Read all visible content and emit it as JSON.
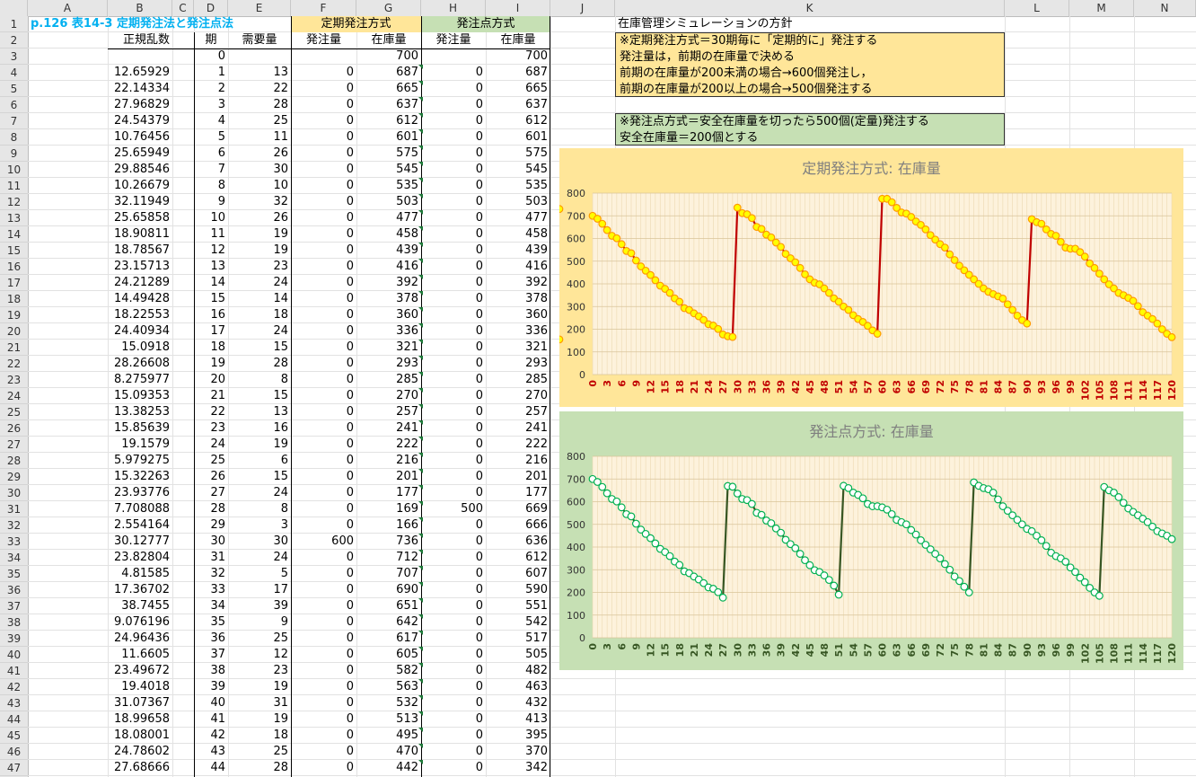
{
  "columns": [
    "A",
    "B",
    "C",
    "D",
    "E",
    "F",
    "G",
    "H",
    "I",
    "J",
    "K",
    "L",
    "M",
    "N"
  ],
  "rows": [
    1,
    2,
    3,
    4,
    5,
    6,
    7,
    8,
    9,
    10,
    11,
    12,
    13,
    14,
    15,
    16,
    17,
    18,
    19,
    20,
    21,
    22,
    23,
    24,
    25,
    26,
    27,
    28,
    29,
    30,
    31,
    32,
    33,
    34,
    35,
    36,
    37,
    38,
    39,
    40,
    41,
    42,
    43,
    44,
    45,
    46,
    47
  ],
  "title": "p.126 表14-3 定期発注法と発注点法",
  "headers": {
    "group_f": "定期発注方式",
    "group_h": "発注点方式",
    "b": "正規乱数",
    "d": "期",
    "e": "需要量",
    "f": "発注量",
    "g": "在庫量",
    "h": "発注量",
    "i": "在庫量"
  },
  "initial": {
    "d": "0",
    "g": "700",
    "i": "700"
  },
  "table": [
    [
      "12.65929",
      "1",
      "13",
      "0",
      "687",
      "0",
      "687"
    ],
    [
      "22.14334",
      "2",
      "22",
      "0",
      "665",
      "0",
      "665"
    ],
    [
      "27.96829",
      "3",
      "28",
      "0",
      "637",
      "0",
      "637"
    ],
    [
      "24.54379",
      "4",
      "25",
      "0",
      "612",
      "0",
      "612"
    ],
    [
      "10.76456",
      "5",
      "11",
      "0",
      "601",
      "0",
      "601"
    ],
    [
      "25.65949",
      "6",
      "26",
      "0",
      "575",
      "0",
      "575"
    ],
    [
      "29.88546",
      "7",
      "30",
      "0",
      "545",
      "0",
      "545"
    ],
    [
      "10.26679",
      "8",
      "10",
      "0",
      "535",
      "0",
      "535"
    ],
    [
      "32.11949",
      "9",
      "32",
      "0",
      "503",
      "0",
      "503"
    ],
    [
      "25.65858",
      "10",
      "26",
      "0",
      "477",
      "0",
      "477"
    ],
    [
      "18.90811",
      "11",
      "19",
      "0",
      "458",
      "0",
      "458"
    ],
    [
      "18.78567",
      "12",
      "19",
      "0",
      "439",
      "0",
      "439"
    ],
    [
      "23.15713",
      "13",
      "23",
      "0",
      "416",
      "0",
      "416"
    ],
    [
      "24.21289",
      "14",
      "24",
      "0",
      "392",
      "0",
      "392"
    ],
    [
      "14.49428",
      "15",
      "14",
      "0",
      "378",
      "0",
      "378"
    ],
    [
      "18.22553",
      "16",
      "18",
      "0",
      "360",
      "0",
      "360"
    ],
    [
      "24.40934",
      "17",
      "24",
      "0",
      "336",
      "0",
      "336"
    ],
    [
      "15.0918",
      "18",
      "15",
      "0",
      "321",
      "0",
      "321"
    ],
    [
      "28.26608",
      "19",
      "28",
      "0",
      "293",
      "0",
      "293"
    ],
    [
      "8.275977",
      "20",
      "8",
      "0",
      "285",
      "0",
      "285"
    ],
    [
      "15.09353",
      "21",
      "15",
      "0",
      "270",
      "0",
      "270"
    ],
    [
      "13.38253",
      "22",
      "13",
      "0",
      "257",
      "0",
      "257"
    ],
    [
      "15.85639",
      "23",
      "16",
      "0",
      "241",
      "0",
      "241"
    ],
    [
      "19.1579",
      "24",
      "19",
      "0",
      "222",
      "0",
      "222"
    ],
    [
      "5.979275",
      "25",
      "6",
      "0",
      "216",
      "0",
      "216"
    ],
    [
      "15.32263",
      "26",
      "15",
      "0",
      "201",
      "0",
      "201"
    ],
    [
      "23.93776",
      "27",
      "24",
      "0",
      "177",
      "0",
      "177"
    ],
    [
      "7.708088",
      "28",
      "8",
      "0",
      "169",
      "500",
      "669"
    ],
    [
      "2.554164",
      "29",
      "3",
      "0",
      "166",
      "0",
      "666"
    ],
    [
      "30.12777",
      "30",
      "30",
      "600",
      "736",
      "0",
      "636"
    ],
    [
      "23.82804",
      "31",
      "24",
      "0",
      "712",
      "0",
      "612"
    ],
    [
      "4.81585",
      "32",
      "5",
      "0",
      "707",
      "0",
      "607"
    ],
    [
      "17.36702",
      "33",
      "17",
      "0",
      "690",
      "0",
      "590"
    ],
    [
      "38.7455",
      "34",
      "39",
      "0",
      "651",
      "0",
      "551"
    ],
    [
      "9.076196",
      "35",
      "9",
      "0",
      "642",
      "0",
      "542"
    ],
    [
      "24.96436",
      "36",
      "25",
      "0",
      "617",
      "0",
      "517"
    ],
    [
      "11.6605",
      "37",
      "12",
      "0",
      "605",
      "0",
      "505"
    ],
    [
      "23.49672",
      "38",
      "23",
      "0",
      "582",
      "0",
      "482"
    ],
    [
      "19.4018",
      "39",
      "19",
      "0",
      "563",
      "0",
      "463"
    ],
    [
      "31.07367",
      "40",
      "31",
      "0",
      "532",
      "0",
      "432"
    ],
    [
      "18.99658",
      "41",
      "19",
      "0",
      "513",
      "0",
      "413"
    ],
    [
      "18.08001",
      "42",
      "18",
      "0",
      "495",
      "0",
      "395"
    ],
    [
      "24.78602",
      "43",
      "25",
      "0",
      "470",
      "0",
      "370"
    ],
    [
      "27.68666",
      "44",
      "28",
      "0",
      "442",
      "0",
      "342"
    ]
  ],
  "notes": {
    "heading": "在庫管理シミュレーションの方針",
    "box1": [
      "※定期発注方式＝30期毎に「定期的に」発注する",
      "発注量は，前期の在庫量で決める",
      "前期の在庫量が200未満の場合→600個発注し，",
      "前期の在庫量が200以上の場合→500個発注する"
    ],
    "box2": [
      "※発注点方式＝安全在庫量を切ったら500個(定量)発注する",
      "安全在庫量＝200個とする"
    ]
  },
  "colors": {
    "orange_fill": "#ffe699",
    "green_fill": "#c6e0b4",
    "title_blue": "#00b0f0",
    "line_red": "#c00000",
    "marker_yellow": "#ffff00",
    "line_green": "#375623",
    "marker_green": "#00b050",
    "tick_green": "#375623"
  },
  "chart_data": [
    {
      "type": "line",
      "title": "定期発注方式: 在庫量",
      "ylim": [
        0,
        800
      ],
      "yticks": [
        "0",
        "100",
        "200",
        "300",
        "400",
        "500",
        "600",
        "700",
        "800"
      ],
      "xticks": [
        "0",
        "3",
        "6",
        "9",
        "12",
        "15",
        "18",
        "21",
        "24",
        "27",
        "30",
        "33",
        "36",
        "39",
        "42",
        "45",
        "48",
        "51",
        "54",
        "57",
        "60",
        "63",
        "66",
        "69",
        "72",
        "75",
        "78",
        "81",
        "84",
        "87",
        "90",
        "93",
        "96",
        "99",
        "102",
        "105",
        "108",
        "111",
        "114",
        "117",
        "120"
      ],
      "grid": true,
      "x": [
        0,
        1,
        2,
        3,
        4,
        5,
        6,
        7,
        8,
        9,
        10,
        11,
        12,
        13,
        14,
        15,
        16,
        17,
        18,
        19,
        20,
        21,
        22,
        23,
        24,
        25,
        26,
        27,
        28,
        29,
        30,
        31,
        32,
        33,
        34,
        35,
        36,
        37,
        38,
        39,
        40,
        41,
        42,
        43,
        44,
        45,
        46,
        47,
        48,
        49,
        50,
        51,
        52,
        53,
        54,
        55,
        56,
        57,
        58,
        59,
        60,
        61,
        62,
        63,
        64,
        65,
        66,
        67,
        68,
        69,
        70,
        71,
        72,
        73,
        74,
        75,
        76,
        77,
        78,
        79,
        80,
        81,
        82,
        83,
        84,
        85,
        86,
        87,
        88,
        89,
        90,
        91,
        92,
        93,
        94,
        95,
        96,
        97,
        98,
        99,
        100,
        101,
        102,
        103,
        104,
        105,
        106,
        107,
        108,
        109,
        110,
        111,
        112,
        113,
        114,
        115,
        116,
        117,
        118,
        119,
        120
      ],
      "values": [
        700,
        687,
        665,
        637,
        612,
        601,
        575,
        545,
        535,
        503,
        477,
        458,
        439,
        416,
        392,
        378,
        360,
        336,
        321,
        293,
        285,
        270,
        257,
        241,
        222,
        216,
        201,
        177,
        169,
        166,
        736,
        712,
        707,
        690,
        651,
        642,
        617,
        605,
        582,
        563,
        532,
        513,
        495,
        470,
        442,
        420,
        405,
        398,
        380,
        360,
        336,
        321,
        300,
        285,
        262,
        245,
        232,
        215,
        195,
        180,
        775,
        775,
        760,
        735,
        715,
        710,
        695,
        675,
        660,
        640,
        615,
        595,
        575,
        560,
        530,
        505,
        480,
        460,
        440,
        420,
        400,
        380,
        365,
        355,
        345,
        335,
        310,
        285,
        260,
        240,
        225,
        685,
        672,
        665,
        640,
        620,
        612,
        585,
        560,
        555,
        555,
        540,
        520,
        490,
        470,
        445,
        420,
        398,
        380,
        360,
        350,
        338,
        325,
        302,
        275,
        260,
        245,
        225,
        200,
        180,
        165,
        155,
        730
      ]
    },
    {
      "type": "line",
      "title": "発注点方式: 在庫量",
      "ylim": [
        0,
        800
      ],
      "yticks": [
        "0",
        "100",
        "200",
        "300",
        "400",
        "500",
        "600",
        "700",
        "800"
      ],
      "xticks": [
        "0",
        "3",
        "6",
        "9",
        "12",
        "15",
        "18",
        "21",
        "24",
        "27",
        "30",
        "33",
        "36",
        "39",
        "42",
        "45",
        "48",
        "51",
        "54",
        "57",
        "60",
        "63",
        "66",
        "69",
        "72",
        "75",
        "78",
        "81",
        "84",
        "87",
        "90",
        "93",
        "96",
        "99",
        "102",
        "105",
        "108",
        "111",
        "114",
        "117",
        "120"
      ],
      "grid": true,
      "x": [
        0,
        1,
        2,
        3,
        4,
        5,
        6,
        7,
        8,
        9,
        10,
        11,
        12,
        13,
        14,
        15,
        16,
        17,
        18,
        19,
        20,
        21,
        22,
        23,
        24,
        25,
        26,
        27,
        28,
        29,
        30,
        31,
        32,
        33,
        34,
        35,
        36,
        37,
        38,
        39,
        40,
        41,
        42,
        43,
        44,
        45,
        46,
        47,
        48,
        49,
        50,
        51,
        52,
        53,
        54,
        55,
        56,
        57,
        58,
        59,
        60,
        61,
        62,
        63,
        64,
        65,
        66,
        67,
        68,
        69,
        70,
        71,
        72,
        73,
        74,
        75,
        76,
        77,
        78,
        79,
        80,
        81,
        82,
        83,
        84,
        85,
        86,
        87,
        88,
        89,
        90,
        91,
        92,
        93,
        94,
        95,
        96,
        97,
        98,
        99,
        100,
        101,
        102,
        103,
        104,
        105,
        106,
        107,
        108,
        109,
        110,
        111,
        112,
        113,
        114,
        115,
        116,
        117,
        118,
        119,
        120
      ],
      "values": [
        700,
        687,
        665,
        637,
        612,
        601,
        575,
        545,
        535,
        503,
        477,
        458,
        439,
        416,
        392,
        378,
        360,
        336,
        321,
        293,
        285,
        270,
        257,
        241,
        222,
        216,
        201,
        177,
        669,
        666,
        636,
        612,
        607,
        590,
        551,
        542,
        517,
        505,
        482,
        463,
        432,
        413,
        395,
        370,
        342,
        320,
        298,
        290,
        275,
        255,
        230,
        190,
        670,
        660,
        640,
        630,
        615,
        590,
        580,
        580,
        575,
        565,
        545,
        520,
        510,
        500,
        475,
        455,
        430,
        410,
        390,
        370,
        350,
        325,
        300,
        270,
        250,
        225,
        200,
        685,
        670,
        660,
        655,
        640,
        610,
        580,
        560,
        540,
        520,
        500,
        480,
        470,
        450,
        430,
        405,
        375,
        360,
        350,
        335,
        310,
        290,
        265,
        245,
        220,
        200,
        185,
        665,
        650,
        640,
        620,
        595,
        570,
        555,
        540,
        525,
        510,
        490,
        470,
        460,
        450,
        435
      ]
    }
  ]
}
